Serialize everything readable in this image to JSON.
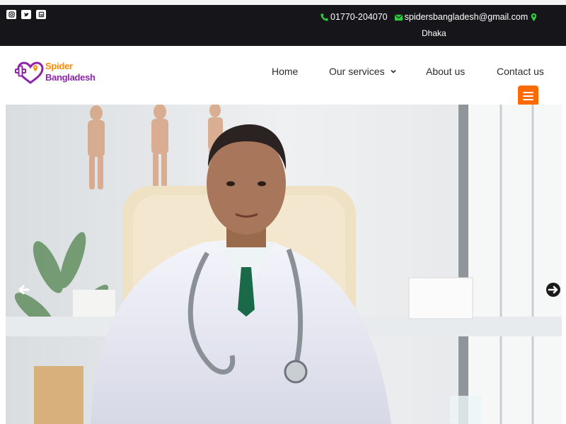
{
  "topbar": {
    "social": [
      {
        "icon": "instagram-icon"
      },
      {
        "icon": "twitter-icon"
      },
      {
        "icon": "linkedin-icon"
      }
    ],
    "phone": "01770-204070",
    "email": "spidersbangladesh@gmail.com",
    "location": "Dhaka",
    "accent_color": "#2ecc40"
  },
  "header": {
    "logo": {
      "line1": "Spider",
      "line2": "Bangladesh",
      "color_primary": "#8e24aa",
      "color_secondary": "#ff8a00"
    },
    "nav": {
      "home": "Home",
      "services": "Our services",
      "about": "About us",
      "contact": "Contact us"
    },
    "menu_toggle_color": "#ff6a00"
  },
  "hero": {
    "prev_icon": "arrow-left-icon",
    "next_icon": "arrow-right-icon"
  }
}
